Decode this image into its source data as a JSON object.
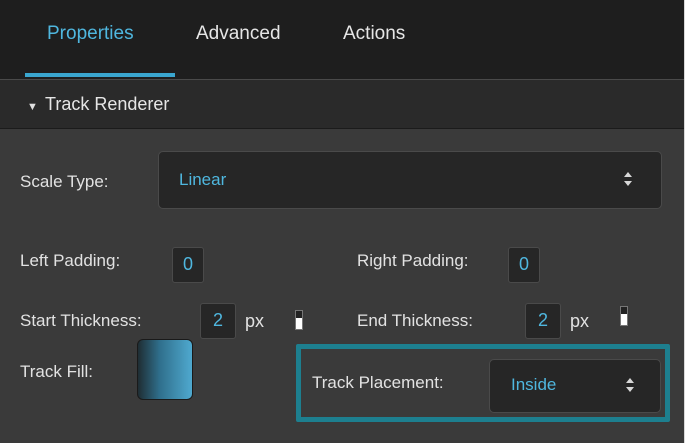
{
  "tabs": [
    {
      "label": "Properties",
      "active": true
    },
    {
      "label": "Advanced",
      "active": false
    },
    {
      "label": "Actions",
      "active": false
    }
  ],
  "section": {
    "title": "Track Renderer",
    "expanded_icon": "triangle-down-icon"
  },
  "scale_type": {
    "label": "Scale Type:",
    "value": "Linear"
  },
  "left_padding": {
    "label": "Left Padding:",
    "value": "0"
  },
  "right_padding": {
    "label": "Right Padding:",
    "value": "0"
  },
  "start_thickness": {
    "label": "Start Thickness:",
    "value": "2",
    "unit": "px"
  },
  "end_thickness": {
    "label": "End Thickness:",
    "value": "2",
    "unit": "px"
  },
  "track_fill": {
    "label": "Track Fill:",
    "color_start": "#1f2d33",
    "color_end": "#4fa9cf"
  },
  "track_placement": {
    "label": "Track Placement:",
    "value": "Inside"
  },
  "colors": {
    "accent": "#4fb7df",
    "highlight": "#1d7f8f",
    "panel_bg": "#3a3a3a",
    "header_bg": "#1e1e1e"
  }
}
